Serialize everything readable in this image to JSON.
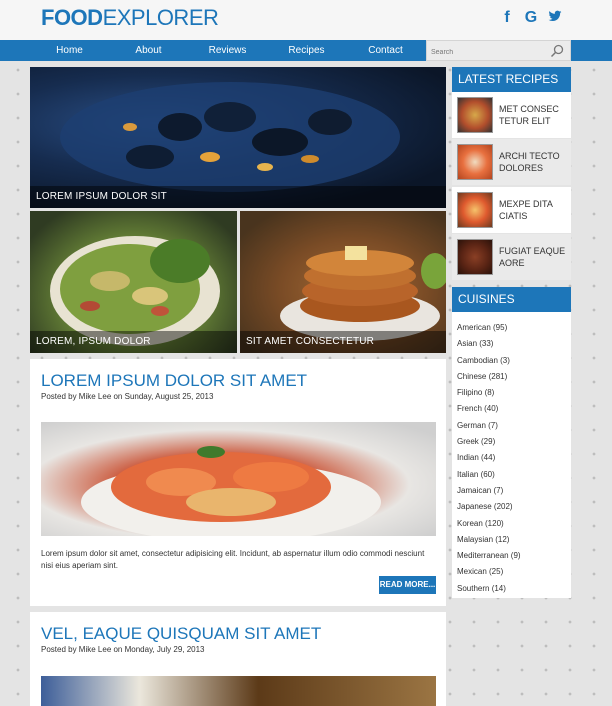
{
  "header": {
    "logo_bold": "FOOD",
    "logo_light": "EXPLORER",
    "social": {
      "facebook": "f",
      "google": "G",
      "twitter": "t"
    }
  },
  "nav": {
    "items": [
      "Home",
      "About",
      "Reviews",
      "Recipes",
      "Contact"
    ],
    "search_placeholder": "Search"
  },
  "featured": [
    {
      "caption": "LOREM IPSUM DOLOR SIT",
      "image": "mussels-photo"
    },
    {
      "caption": "LOREM, IPSUM DOLOR",
      "image": "salad-photo"
    },
    {
      "caption": "SIT AMET CONSECTETUR",
      "image": "pancakes-photo"
    }
  ],
  "posts": [
    {
      "title": "LOREM IPSUM DOLOR SIT AMET",
      "meta": "Posted by Mike Lee on Sunday, August 25, 2013",
      "excerpt": "Lorem ipsum dolor sit amet, consectetur adipisicing elit. Incidunt, ab aspernatur illum odio commodi nesciunt nisi eius aperiam sint.",
      "read_more": "READ MORE...",
      "image": "shrimp-pasta-photo"
    },
    {
      "title": "VEL, EAQUE QUISQUAM SIT AMET",
      "meta": "Posted by Mike Lee on Monday, July 29, 2013",
      "image": "ramen-photo"
    }
  ],
  "sidebar": {
    "latest_title": "LATEST RECIPES",
    "recipes": [
      {
        "title": "MET CONSEC TETUR ELIT"
      },
      {
        "title": "ARCHI TECTO DOLORES"
      },
      {
        "title": "MEXPE DITA CIATIS"
      },
      {
        "title": "FUGIAT EAQUE AORE"
      }
    ],
    "cuisines_title": "CUISINES",
    "cuisines": [
      "American (95)",
      "Asian (33)",
      "Cambodian (3)",
      "Chinese (281)",
      "Filipino (8)",
      "French (40)",
      "German (7)",
      "Greek (29)",
      "Indian (44)",
      "Italian (60)",
      "Jamaican (7)",
      "Japanese (202)",
      "Korean (120)",
      "Malaysian (12)",
      "Mediterranean (9)",
      "Mexican (25)",
      "Southern (14)"
    ]
  },
  "colors": {
    "accent": "#1d76b9",
    "background": "#e4e4e4"
  }
}
